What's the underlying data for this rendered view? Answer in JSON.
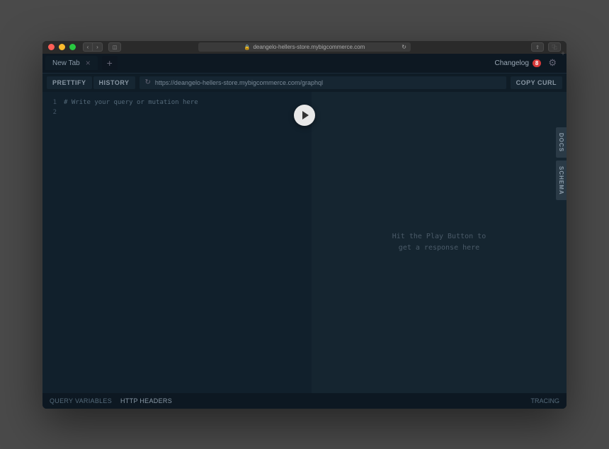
{
  "browser": {
    "url_display": "deangelo-hellers-store.mybigcommerce.com"
  },
  "app": {
    "tab_label": "New Tab",
    "changelog_label": "Changelog",
    "changelog_count": "8"
  },
  "toolbar": {
    "prettify": "PRETTIFY",
    "history": "HISTORY",
    "copy_curl": "COPY CURL",
    "endpoint": "https://deangelo-hellers-store.mybigcommerce.com/graphql"
  },
  "editor": {
    "line1_num": "1",
    "line1_text": "# Write your query or mutation here",
    "line2_num": "2"
  },
  "response": {
    "placeholder": "Hit the Play Button to\nget a response here"
  },
  "side_tabs": {
    "docs": "DOCS",
    "schema": "SCHEMA"
  },
  "footer": {
    "query_vars": "QUERY VARIABLES",
    "http_headers": "HTTP HEADERS",
    "tracing": "TRACING"
  }
}
